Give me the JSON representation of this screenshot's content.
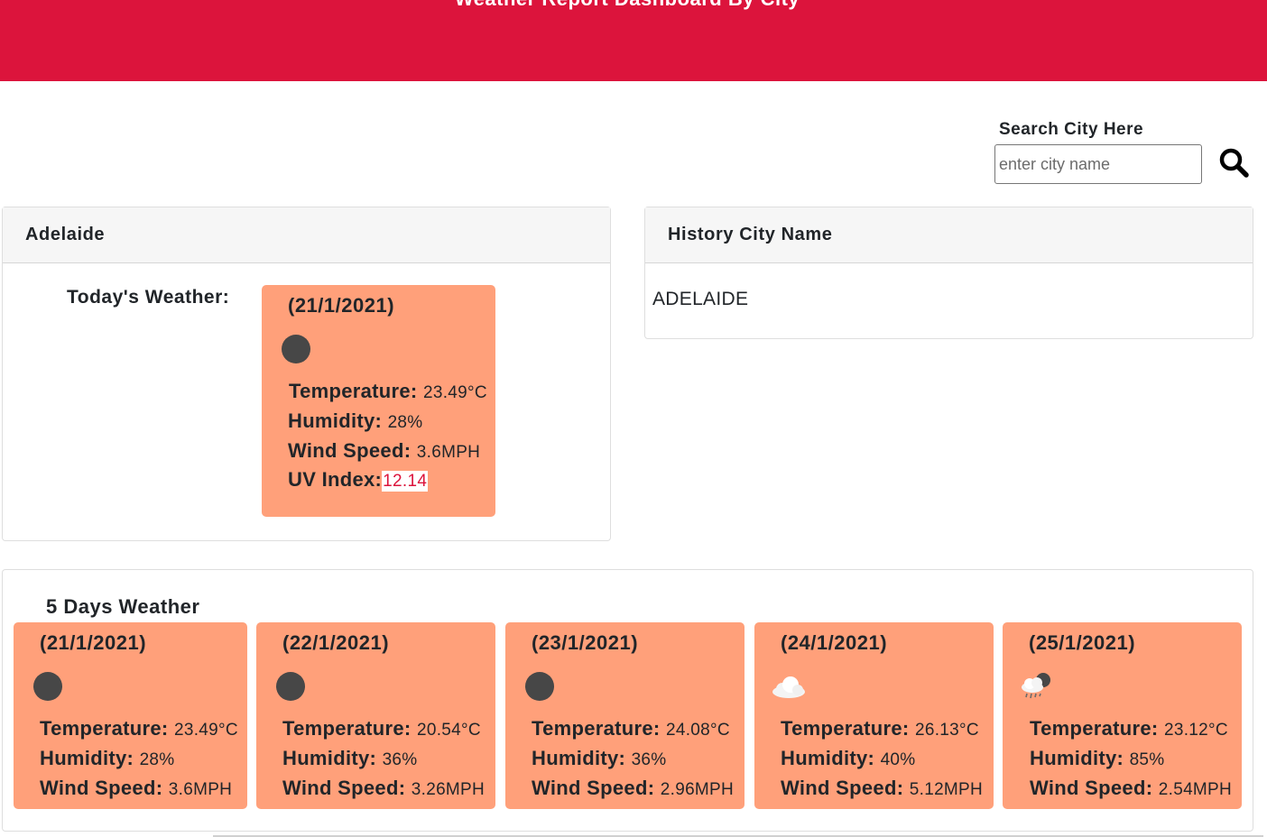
{
  "header": {
    "title": "Weather Report Dashboard By City"
  },
  "search": {
    "label": "Search City Here",
    "placeholder": "enter city name",
    "value": ""
  },
  "current": {
    "city": "Adelaide",
    "today_label": "Today's Weather:",
    "date": "(21/1/2021)",
    "icon": "clear-night-icon",
    "temperature_label": "Temperature:",
    "temperature": "23.49°C",
    "humidity_label": "Humidity:",
    "humidity": "28%",
    "wind_label": "Wind Speed:",
    "wind": "3.6MPH",
    "uv_label": "UV Index:",
    "uv": "12.14"
  },
  "history": {
    "title": "History City Name",
    "items": [
      "ADELAIDE"
    ]
  },
  "forecast": {
    "title": "5 Days Weather",
    "temperature_label": "Temperature:",
    "humidity_label": "Humidity:",
    "wind_label": "Wind Speed:",
    "days": [
      {
        "date": "(21/1/2021)",
        "icon": "clear-night-icon",
        "temperature": "23.49°C",
        "humidity": "28%",
        "wind": "3.6MPH"
      },
      {
        "date": "(22/1/2021)",
        "icon": "clear-night-icon",
        "temperature": "20.54°C",
        "humidity": "36%",
        "wind": "3.26MPH"
      },
      {
        "date": "(23/1/2021)",
        "icon": "clear-night-icon",
        "temperature": "24.08°C",
        "humidity": "36%",
        "wind": "2.96MPH"
      },
      {
        "date": "(24/1/2021)",
        "icon": "cloud-icon",
        "temperature": "26.13°C",
        "humidity": "40%",
        "wind": "5.12MPH"
      },
      {
        "date": "(25/1/2021)",
        "icon": "rain-night-icon",
        "temperature": "23.12°C",
        "humidity": "85%",
        "wind": "2.54MPH"
      }
    ]
  },
  "colors": {
    "banner": "#dc143c",
    "card": "#ffa07a",
    "uv_text": "#dc143c"
  }
}
